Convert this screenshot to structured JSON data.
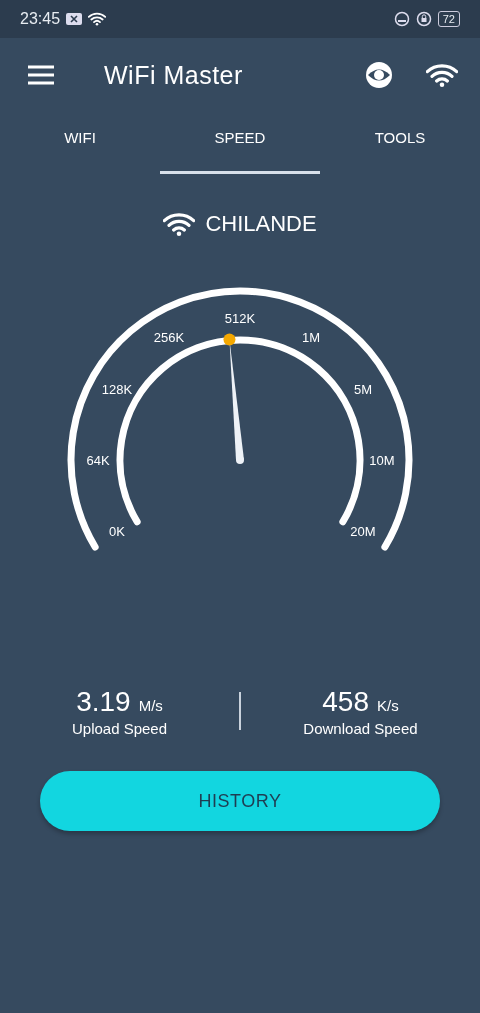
{
  "status_bar": {
    "time": "23:45",
    "battery": "72"
  },
  "app_bar": {
    "title": "WiFi Master"
  },
  "tabs": [
    {
      "label": "WIFI",
      "selected": false
    },
    {
      "label": "SPEED",
      "selected": true
    },
    {
      "label": "TOOLS",
      "selected": false
    }
  ],
  "network": {
    "name": "CHILANDE"
  },
  "gauge": {
    "labels": [
      "0K",
      "64K",
      "128K",
      "256K",
      "512K",
      "1M",
      "5M",
      "10M",
      "20M"
    ]
  },
  "speeds": [
    {
      "value": "3.19",
      "unit": "M/s",
      "label": "Upload Speed"
    },
    {
      "value": "458",
      "unit": "K/s",
      "label": "Download Speed"
    }
  ],
  "button": {
    "label": "HISTORY"
  }
}
